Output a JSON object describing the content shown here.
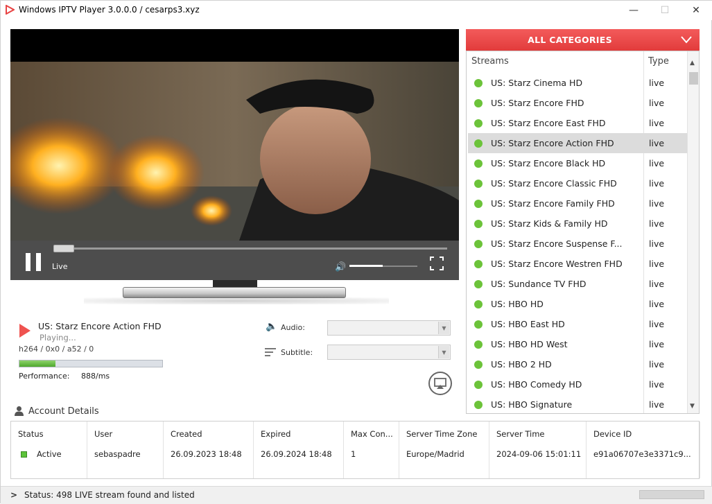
{
  "window": {
    "title": "Windows IPTV Player 3.0.0.0 / cesarps3.xyz",
    "minimize": "—",
    "maximize": "☐",
    "close": "✕"
  },
  "player": {
    "live_label": "Live",
    "seek_progress": 0.0,
    "volume_level": 0.5
  },
  "now_playing": {
    "title": "US: Starz Encore Action FHD",
    "status": "Playing...",
    "codec": "h264 / 0x0 / a52  / 0",
    "buffer_level": 0.25,
    "performance_label": "Performance:",
    "performance_value": "888/ms"
  },
  "options": {
    "audio_label": "Audio:",
    "subtitle_label": "Subtitle:",
    "audio_value": "",
    "subtitle_value": ""
  },
  "categories": {
    "title": "ALL CATEGORIES",
    "col_streams": "Streams",
    "col_type": "Type",
    "accent": "#e84343",
    "live_dot_color": "#6cc33a",
    "items": [
      {
        "name": "US: Starz Cinema HD",
        "type": "live"
      },
      {
        "name": "US: Starz Encore FHD",
        "type": "live"
      },
      {
        "name": "US: Starz Encore East FHD",
        "type": "live"
      },
      {
        "name": "US: Starz Encore Action FHD",
        "type": "live",
        "selected": true
      },
      {
        "name": "US: Starz Encore Black HD",
        "type": "live"
      },
      {
        "name": "US: Starz Encore Classic FHD",
        "type": "live"
      },
      {
        "name": "US: Starz Encore Family FHD",
        "type": "live"
      },
      {
        "name": "US: Starz Kids & Family HD",
        "type": "live"
      },
      {
        "name": "US: Starz Encore Suspense F...",
        "type": "live"
      },
      {
        "name": "US: Starz Encore Westren FHD",
        "type": "live"
      },
      {
        "name": "US: Sundance TV FHD",
        "type": "live"
      },
      {
        "name": "US: HBO HD",
        "type": "live"
      },
      {
        "name": "US: HBO East HD",
        "type": "live"
      },
      {
        "name": "US: HBO HD West",
        "type": "live"
      },
      {
        "name": "US: HBO 2 HD",
        "type": "live"
      },
      {
        "name": "US: HBO Comedy HD",
        "type": "live"
      },
      {
        "name": "US: HBO Signature",
        "type": "live"
      }
    ]
  },
  "account": {
    "title": "Account Details",
    "headers": [
      "Status",
      "User",
      "Created",
      "Expired",
      "Max Con...",
      "Server Time Zone",
      "Server Time",
      "Device ID"
    ],
    "values": [
      "Active",
      "sebaspadre",
      "26.09.2023 18:48",
      "26.09.2024 18:48",
      "1",
      "Europe/Madrid",
      "2024-09-06 15:01:11",
      "e91a06707e3e3371c9..."
    ]
  },
  "statusbar": {
    "text": "Status: 498 LIVE stream found and listed"
  }
}
